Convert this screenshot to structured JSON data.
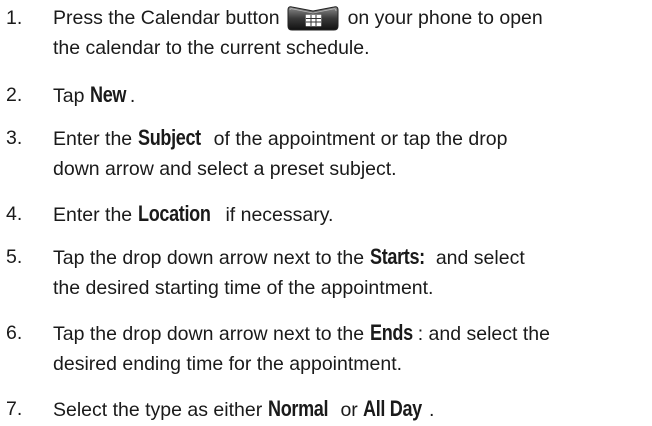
{
  "steps": [
    {
      "number": "1.",
      "before_icon": "Press the Calendar button",
      "icon": "calendar-button-icon",
      "after_icon": "on your phone to open",
      "line2": "the calendar to the current schedule."
    },
    {
      "number": "2.",
      "pre": "Tap ",
      "kw": "New",
      "post": "."
    },
    {
      "number": "3.",
      "pre": "Enter the ",
      "kw": "Subject",
      "post": " of the appointment or tap the drop",
      "line2": "down arrow and select a preset subject."
    },
    {
      "number": "4.",
      "pre": "Enter the ",
      "kw": "Location",
      "post": " if necessary."
    },
    {
      "number": "5.",
      "pre": "Tap the drop down arrow next to the ",
      "kw": "Starts:",
      "post": " and select",
      "line2": "the desired starting time of the appointment."
    },
    {
      "number": "6.",
      "pre": "Tap the drop down arrow next to the ",
      "kw": "Ends",
      "post": ": and select the",
      "line2": "desired ending time for the appointment."
    },
    {
      "number": "7.",
      "pre": "Select the type as either ",
      "kw": "Normal",
      "mid": " or ",
      "kw2": "All Day",
      "post": "."
    }
  ]
}
